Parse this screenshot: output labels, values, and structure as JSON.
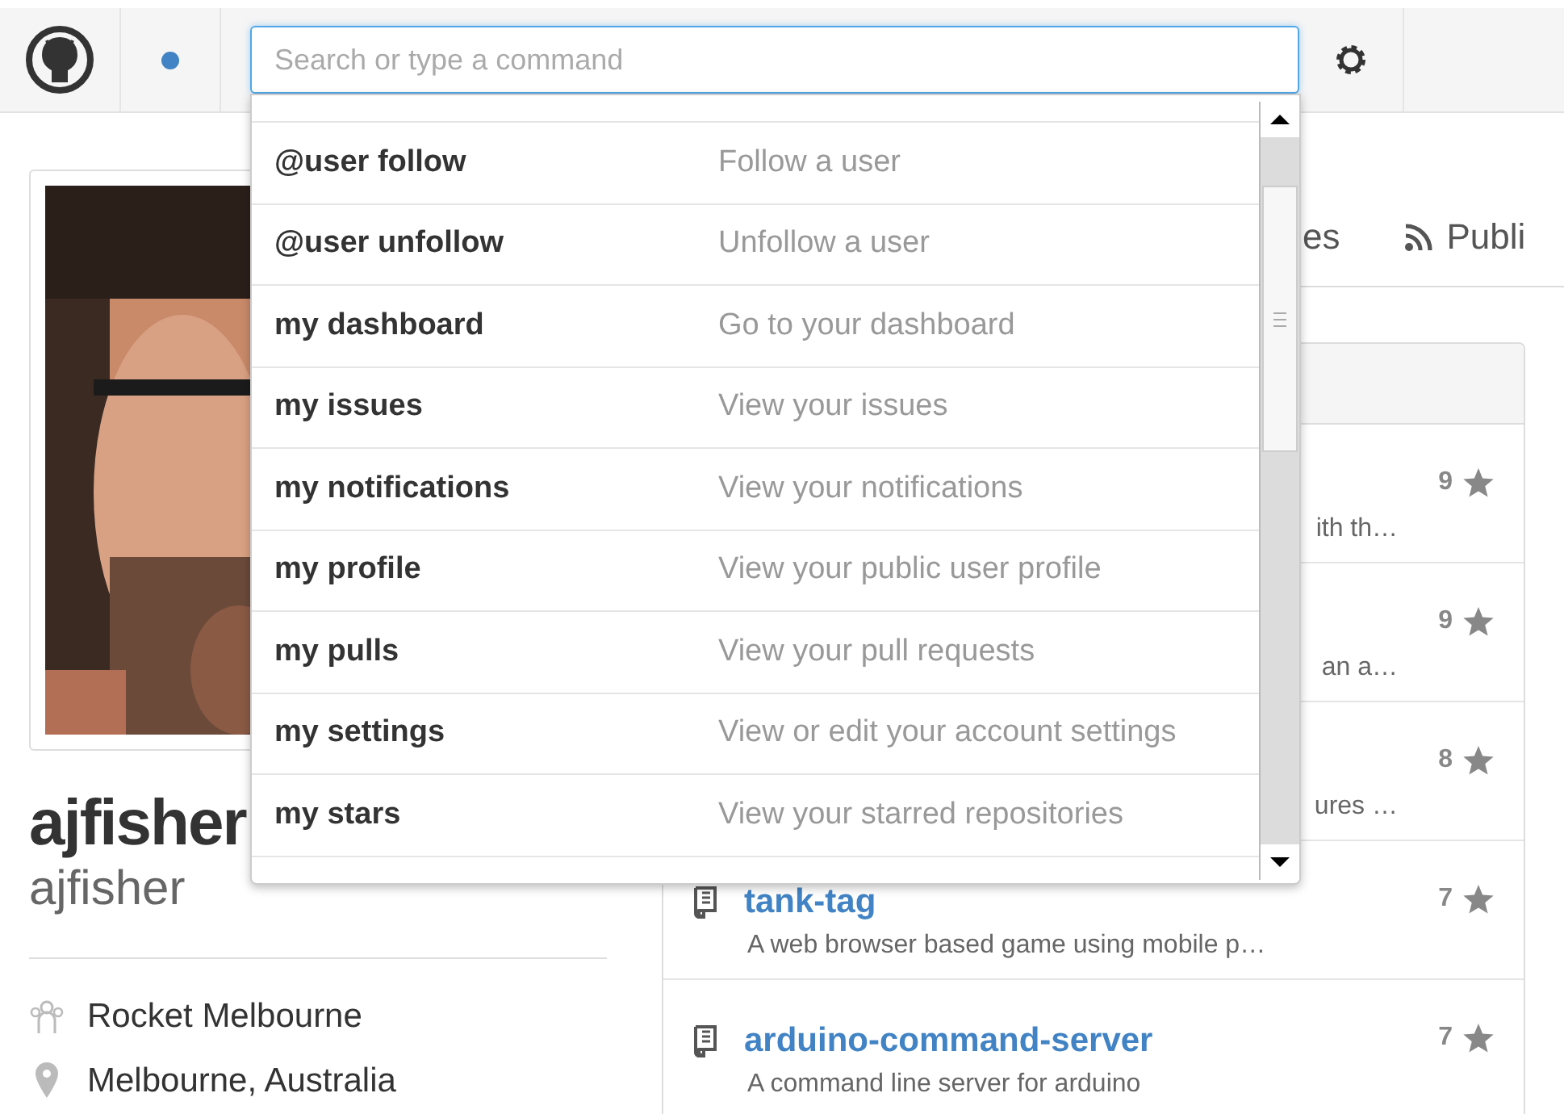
{
  "header": {
    "search": {
      "placeholder": "Search or type a command"
    }
  },
  "command_menu": {
    "items": [
      {
        "command": "@user follow",
        "description": "Follow a user"
      },
      {
        "command": "@user unfollow",
        "description": "Unfollow a user"
      },
      {
        "command": "my dashboard",
        "description": "Go to your dashboard"
      },
      {
        "command": "my issues",
        "description": "View your issues"
      },
      {
        "command": "my notifications",
        "description": "View your notifications"
      },
      {
        "command": "my profile",
        "description": "View your public user profile"
      },
      {
        "command": "my pulls",
        "description": "View your pull requests"
      },
      {
        "command": "my settings",
        "description": "View or edit your account settings"
      },
      {
        "command": "my stars",
        "description": "View your starred repositories"
      }
    ]
  },
  "profile": {
    "full_name": "ajfisher",
    "username": "ajfisher",
    "details": [
      {
        "kind": "organization",
        "text": "Rocket Melbourne"
      },
      {
        "kind": "location",
        "text": "Melbourne, Australia"
      }
    ]
  },
  "tabs": [
    {
      "kind": "plain",
      "label": "es"
    },
    {
      "kind": "feed",
      "label": "Publi"
    }
  ],
  "repositories": [
    {
      "kind": "covered",
      "stars": "9",
      "description": "ith th…"
    },
    {
      "kind": "covered",
      "stars": "9",
      "description": "an a…"
    },
    {
      "kind": "covered",
      "stars": "8",
      "description": "ures …"
    },
    {
      "kind": "full",
      "name": "tank-tag",
      "stars": "7",
      "description": "A web browser based game using mobile p…"
    },
    {
      "kind": "full",
      "name": "arduino-command-server",
      "stars": "7",
      "description": "A command line server for arduino"
    }
  ]
}
